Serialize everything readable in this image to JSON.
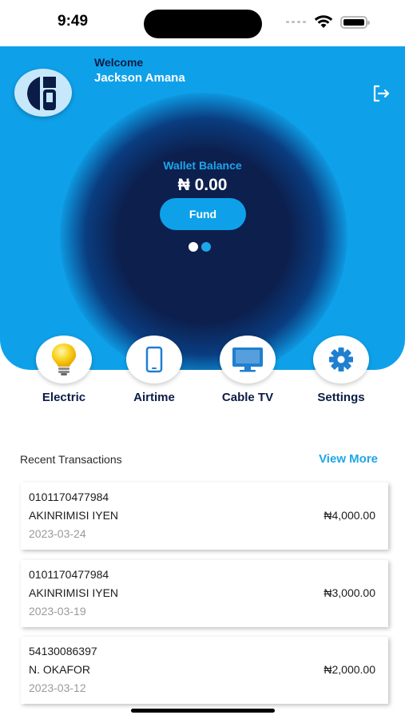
{
  "status_bar": {
    "time": "9:49"
  },
  "header": {
    "welcome": "Welcome",
    "user_name": "Jackson Amana",
    "wallet": {
      "label": "Wallet Balance",
      "balance": "₦ 0.00",
      "fund_label": "Fund",
      "page_count": 2,
      "active_page": 1
    },
    "icons": {
      "avatar": "brand-logo-icon",
      "logout": "logout-icon"
    }
  },
  "quick_actions": [
    {
      "label": "Electric",
      "icon": "lightbulb-icon"
    },
    {
      "label": "Airtime",
      "icon": "phone-icon"
    },
    {
      "label": "Cable TV",
      "icon": "tv-icon"
    },
    {
      "label": "Settings",
      "icon": "gear-icon"
    }
  ],
  "transactions": {
    "title": "Recent Transactions",
    "view_more": "View More",
    "items": [
      {
        "account": "0101170477984",
        "name": "AKINRIMISI IYEN",
        "date": "2023-03-24",
        "amount": "₦4,000.00"
      },
      {
        "account": "0101170477984",
        "name": "AKINRIMISI IYEN",
        "date": "2023-03-19",
        "amount": "₦3,000.00"
      },
      {
        "account": "54130086397",
        "name": "N. OKAFOR",
        "date": "2023-03-12",
        "amount": "₦2,000.00"
      }
    ]
  },
  "colors": {
    "accent": "#0ea1ea",
    "dark_navy": "#0c1f4d",
    "label_navy": "#0b1c47",
    "date_gray": "#9a9a9a"
  }
}
